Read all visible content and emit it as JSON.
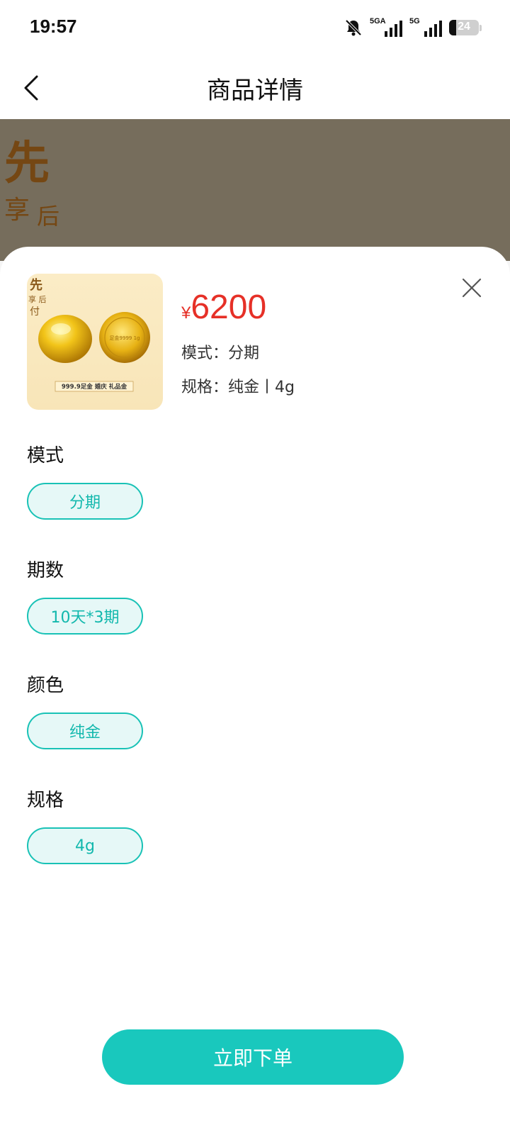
{
  "status_bar": {
    "time": "19:57",
    "battery": "24",
    "sim1": "5GA",
    "sim2": "5G"
  },
  "nav": {
    "title": "商品详情"
  },
  "banner": {
    "calligraphy": "先享后付"
  },
  "product": {
    "price_symbol": "¥",
    "price": "6200",
    "mode_label": "模式",
    "mode_value": "分期",
    "spec_label": "规格",
    "spec_value": "纯金丨4g",
    "image_calligraphy": "先享后付",
    "image_caption": "999.9足金 婚庆 礼品金",
    "coin_text": "足金9999 1g"
  },
  "options": [
    {
      "title": "模式",
      "value": "分期"
    },
    {
      "title": "期数",
      "value": "10天*3期"
    },
    {
      "title": "颜色",
      "value": "纯金"
    },
    {
      "title": "规格",
      "value": "4g"
    }
  ],
  "footer": {
    "order_label": "立即下单"
  },
  "colors": {
    "accent": "#19c8bd",
    "price": "#e63027",
    "pill_bg": "#e6f8f7"
  }
}
